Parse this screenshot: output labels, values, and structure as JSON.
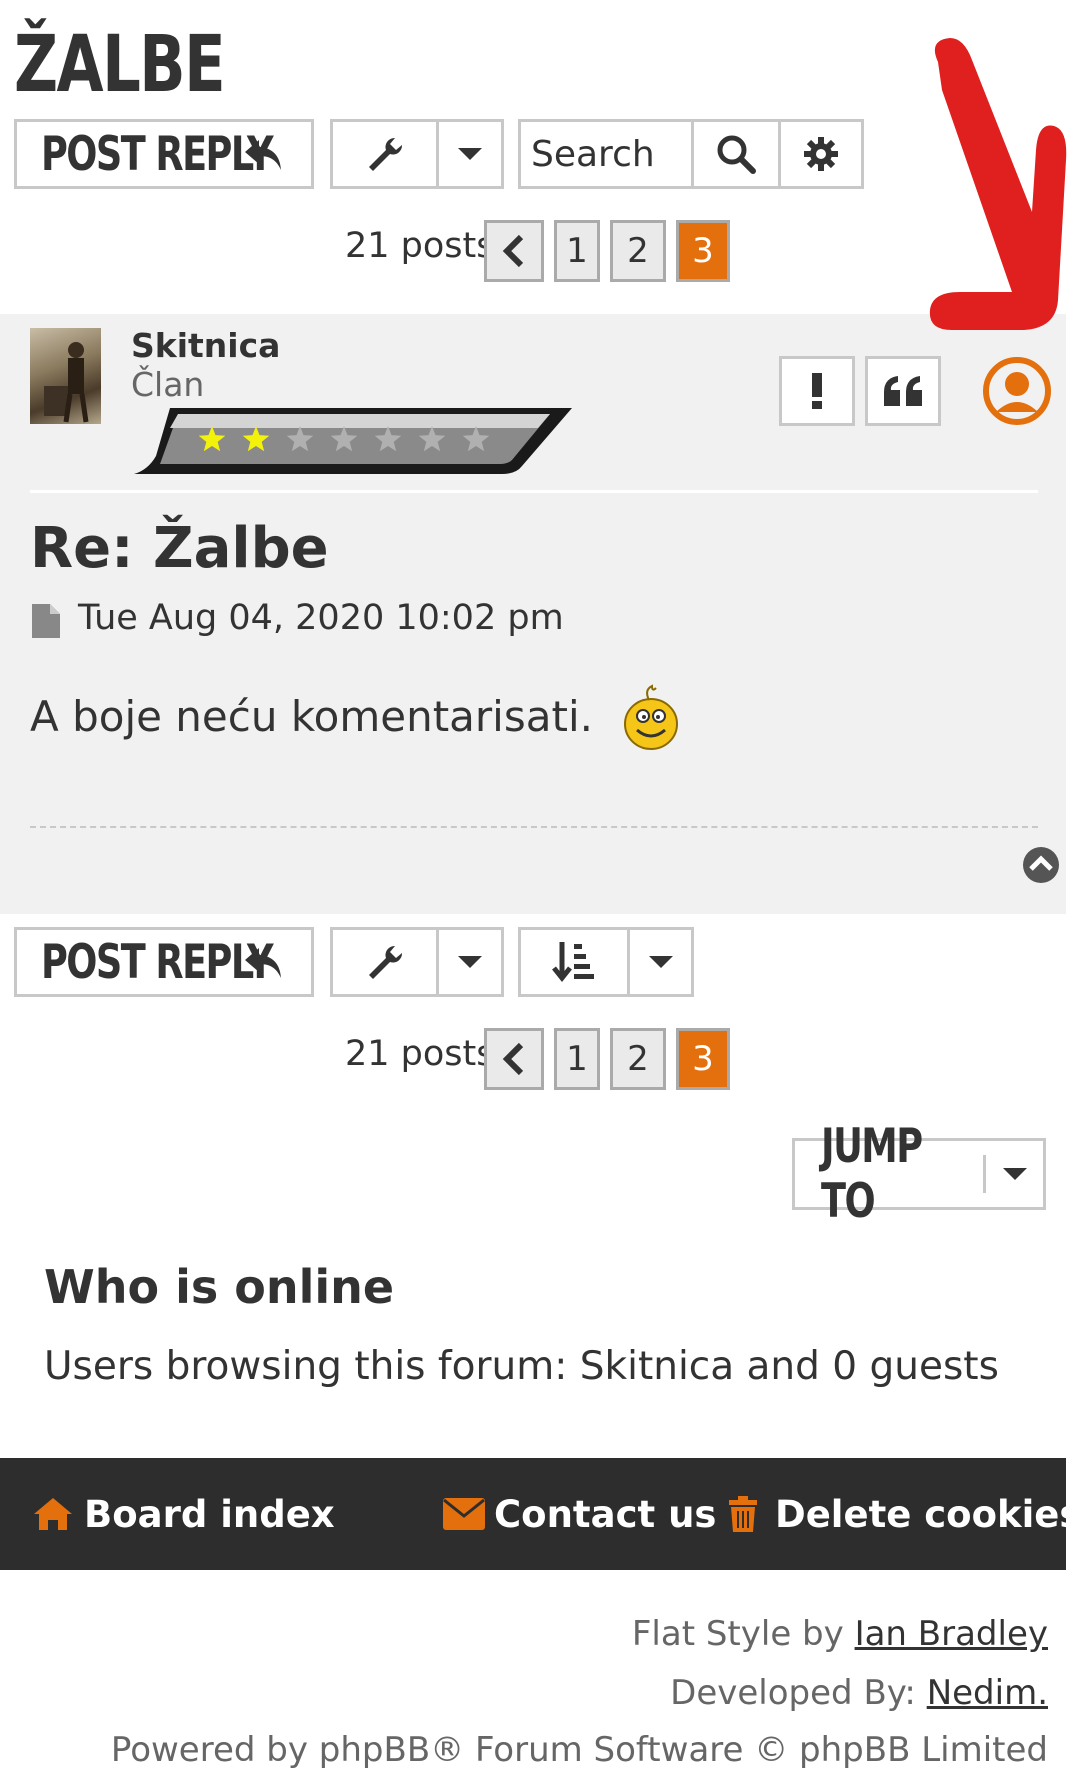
{
  "topic": {
    "title": "ŽALBE"
  },
  "action_bar_top": {
    "post_reply_label": "POST REPLY",
    "search_placeholder": "Search",
    "pagination": {
      "count": "21 posts",
      "pages": [
        "1",
        "2",
        "3"
      ],
      "current": "3"
    }
  },
  "post": {
    "author": "Skitnica",
    "rank": "Član",
    "rank_stars_filled": 2,
    "rank_stars_total": 7,
    "title": "Re: Žalbe",
    "date": "Tue Aug 04, 2020 10:02 pm",
    "body": "A boje neću komentarisati."
  },
  "action_bar_bottom": {
    "post_reply_label": "POST REPLY",
    "pagination": {
      "count": "21 posts",
      "pages": [
        "1",
        "2",
        "3"
      ],
      "current": "3"
    }
  },
  "jump_to": {
    "label": "JUMP TO"
  },
  "who_is_online": {
    "heading": "Who is online",
    "text": "Users browsing this forum: ",
    "user": "Skitnica",
    "suffix": " and 0 guests"
  },
  "footer": {
    "board_index": "Board index",
    "contact_us": "Contact us",
    "delete_cookies": "Delete cookies"
  },
  "credits": {
    "style_prefix": "Flat Style by ",
    "style_author": "Ian Bradley",
    "dev_prefix": "Developed By: ",
    "dev_author": "Nedim.",
    "powered": "Powered by phpBB® Forum Software © phpBB Limited"
  },
  "colors": {
    "accent": "#e36f0d",
    "annotation_arrow": "#e0201e",
    "footer_bg": "#2d2d2d",
    "panel_bg": "#f1f1f1"
  }
}
